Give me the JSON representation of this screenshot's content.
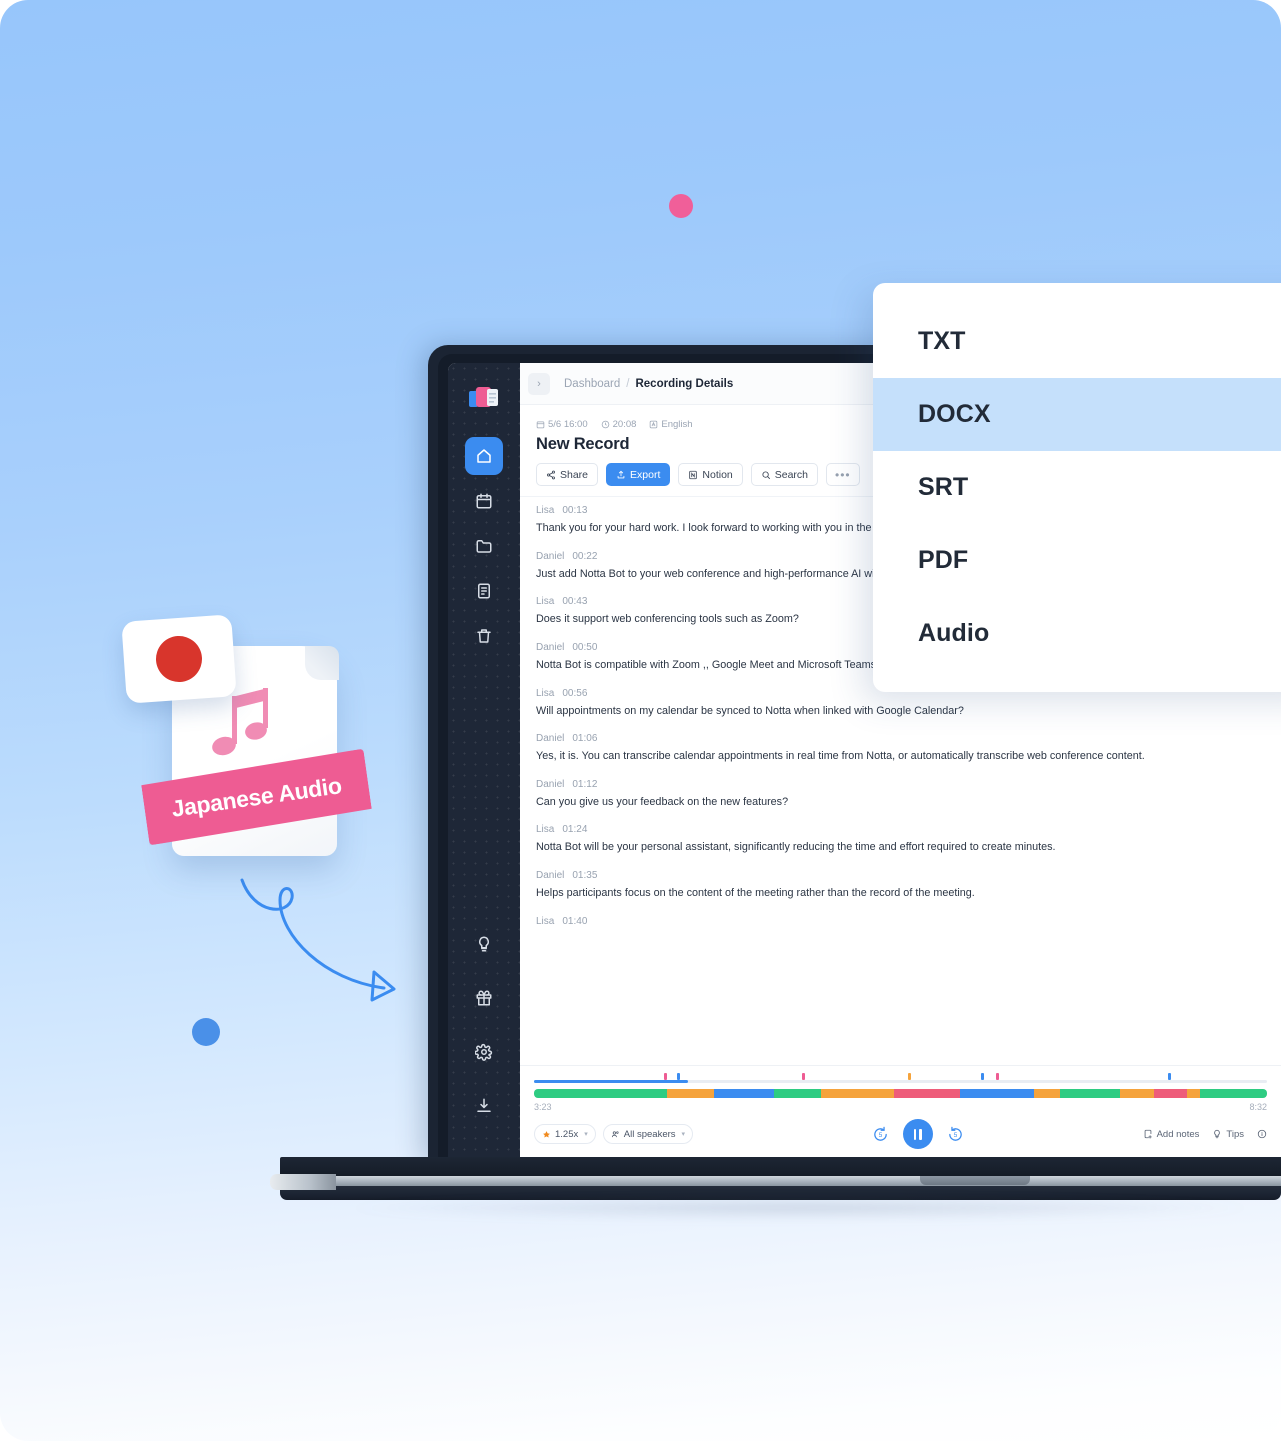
{
  "theme": {
    "accent_blue": "#3b8cf0",
    "accent_pink": "#ee5c93",
    "sidebar_dark": "#1e2737",
    "bg_top": "#97c6fb",
    "bg_bottom": "#ffffff",
    "flag_red": "#d8352c",
    "highlight_blue": "#c5e0fb"
  },
  "sidebar": {
    "logo_name": "notta-logo",
    "items": [
      {
        "name": "home",
        "label": "Home",
        "active": true
      },
      {
        "name": "calendar",
        "label": "Calendar",
        "active": false
      },
      {
        "name": "folder",
        "label": "Folders",
        "active": false
      },
      {
        "name": "notes",
        "label": "Notes",
        "active": false
      },
      {
        "name": "trash",
        "label": "Trash",
        "active": false
      }
    ],
    "lower_items": [
      {
        "name": "tips",
        "label": "Tips"
      },
      {
        "name": "gift",
        "label": "Gift"
      },
      {
        "name": "settings",
        "label": "Settings"
      },
      {
        "name": "download",
        "label": "Download"
      }
    ]
  },
  "breadcrumb": {
    "collapse_icon": "›",
    "root": "Dashboard",
    "separator": "/",
    "current": "Recording Details"
  },
  "record": {
    "date": "5/6 16:00",
    "duration": "20:08",
    "language": "English",
    "title": "New Record"
  },
  "toolbar": {
    "share_label": "Share",
    "export_label": "Export",
    "notion_label": "Notion",
    "search_label": "Search",
    "more_label": "•••"
  },
  "export_menu": {
    "items": [
      {
        "label": "TXT",
        "highlight": false
      },
      {
        "label": "DOCX",
        "highlight": true
      },
      {
        "label": "SRT",
        "highlight": false
      },
      {
        "label": "PDF",
        "highlight": false
      },
      {
        "label": "Audio",
        "highlight": false
      }
    ]
  },
  "transcript": [
    {
      "speaker": "Lisa",
      "time": "00:13",
      "text": "Thank you for your hard work. I look forward to working with you in the future.",
      "wrap": false
    },
    {
      "speaker": "Daniel",
      "time": "00:22",
      "text": "Just add Notta Bot to your web conference and high-performance AI will transcribe it.",
      "wrap": false
    },
    {
      "speaker": "Lisa",
      "time": "00:43",
      "text": "Does it support web conferencing tools such as Zoom?",
      "wrap": false
    },
    {
      "speaker": "Daniel",
      "time": "00:50",
      "text": "Notta Bot is compatible with Zoom ,, Google Meet and Microsoft Teams. It is also possible to link with Google Calendar.",
      "wrap": false
    },
    {
      "speaker": "Lisa",
      "time": "00:56",
      "text": "Will appointments on my calendar be synced to Notta when linked with Google Calendar?",
      "wrap": false
    },
    {
      "speaker": "Daniel",
      "time": "01:06",
      "text": "Yes, it is. You can transcribe calendar appointments in real time from Notta, or automatically transcribe web conference content.",
      "wrap": false
    },
    {
      "speaker": "Daniel",
      "time": "01:12",
      "text": "Can you give us your feedback on the new features?",
      "wrap": false
    },
    {
      "speaker": "Lisa",
      "time": "01:24",
      "text": "Notta Bot will be your personal assistant, significantly reducing the time and effort required to create minutes.",
      "wrap": true
    },
    {
      "speaker": "Daniel",
      "time": "01:35",
      "text": "Helps participants focus on the content of the meeting rather than the record of the meeting.",
      "wrap": false
    },
    {
      "speaker": "Lisa",
      "time": "01:40",
      "text": "",
      "wrap": false
    }
  ],
  "player": {
    "current_time": "3:23",
    "total_time": "8:32",
    "progress_percent": 21,
    "speed_label": "1.25x",
    "speakers_label": "All speakers",
    "add_notes_label": "Add notes",
    "tips_label": "Tips",
    "info_label": "Info",
    "marks": [
      {
        "left_percent": 17.8,
        "color": "#ee5c93"
      },
      {
        "left_percent": 19.5,
        "color": "#3b8cf0"
      },
      {
        "left_percent": 36.5,
        "color": "#ee5c93"
      },
      {
        "left_percent": 51.0,
        "color": "#f5a33c"
      },
      {
        "left_percent": 61.0,
        "color": "#3b8cf0"
      },
      {
        "left_percent": 63.0,
        "color": "#ee5c93"
      },
      {
        "left_percent": 86.5,
        "color": "#3b8cf0"
      }
    ],
    "wave_segments": [
      {
        "width_percent": 20,
        "color": "#2ecc82"
      },
      {
        "width_percent": 7,
        "color": "#f5a33c"
      },
      {
        "width_percent": 9,
        "color": "#3b8cf0"
      },
      {
        "width_percent": 7,
        "color": "#2ecc82"
      },
      {
        "width_percent": 11,
        "color": "#f5a33c"
      },
      {
        "width_percent": 10,
        "color": "#ee5c7a"
      },
      {
        "width_percent": 11,
        "color": "#3b8cf0"
      },
      {
        "width_percent": 4,
        "color": "#f5a33c"
      },
      {
        "width_percent": 9,
        "color": "#2ecc82"
      },
      {
        "width_percent": 5,
        "color": "#f5a33c"
      },
      {
        "width_percent": 5,
        "color": "#ee5c7a"
      },
      {
        "width_percent": 2,
        "color": "#f5a33c"
      },
      {
        "width_percent": 10,
        "color": "#2ecc82"
      }
    ]
  },
  "badge": {
    "ribbon_text": "Japanese Audio",
    "flag_name": "japan-flag",
    "file_icon_name": "audio-file"
  }
}
